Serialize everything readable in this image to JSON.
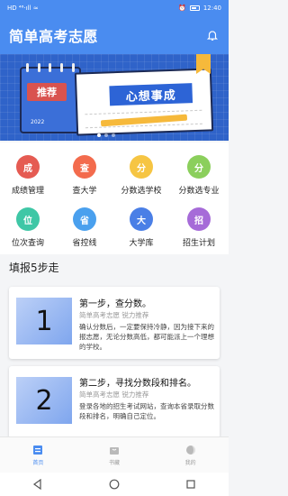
{
  "status_bar": {
    "left": "HD ⁴⁶·ıll ≈",
    "right_icons": [
      "alarm-icon",
      "battery-icon"
    ],
    "time": "12:40"
  },
  "app": {
    "title": "简单高考志愿"
  },
  "banner": {
    "notebook_tag": "推荐",
    "notebook_year": "2022",
    "paper_text": "心想事成"
  },
  "shortcuts": [
    {
      "glyph": "成",
      "label": "成绩管理",
      "color": "#e55b52"
    },
    {
      "glyph": "查",
      "label": "查大学",
      "color": "#f36b4d"
    },
    {
      "glyph": "分",
      "label": "分数选学校",
      "color": "#f6c543"
    },
    {
      "glyph": "分",
      "label": "分数选专业",
      "color": "#8bcf5c"
    },
    {
      "glyph": "位",
      "label": "位次查询",
      "color": "#3fc7a6"
    },
    {
      "glyph": "省",
      "label": "省控线",
      "color": "#4aa0ee"
    },
    {
      "glyph": "大",
      "label": "大学库",
      "color": "#4a7fe6"
    },
    {
      "glyph": "招",
      "label": "招生计划",
      "color": "#a66bd8"
    }
  ],
  "section": {
    "title": "填报5步走"
  },
  "cards": [
    {
      "number": "1",
      "title": "第一步，查分数。",
      "meta": "简单高考志愿  锐力推荐",
      "body": "确认分数后，一定要保持冷静，因为接下来的报志愿，无论分数高低，都可能派上一个理想的学校。"
    },
    {
      "number": "2",
      "title": "第二步，寻找分数段和排名。",
      "meta": "简单高考志愿  锐力推荐",
      "body": "登录各地的招生考试网站，查询本省录取分数段和排名，明确自己定位。"
    }
  ],
  "bottom_nav": [
    {
      "label": "首页",
      "icon": "home-icon",
      "active": true
    },
    {
      "label": "书藏",
      "icon": "bag-icon",
      "active": false
    },
    {
      "label": "我的",
      "icon": "profile-icon",
      "active": false
    }
  ],
  "colors": {
    "primary": "#4a8cf0"
  }
}
